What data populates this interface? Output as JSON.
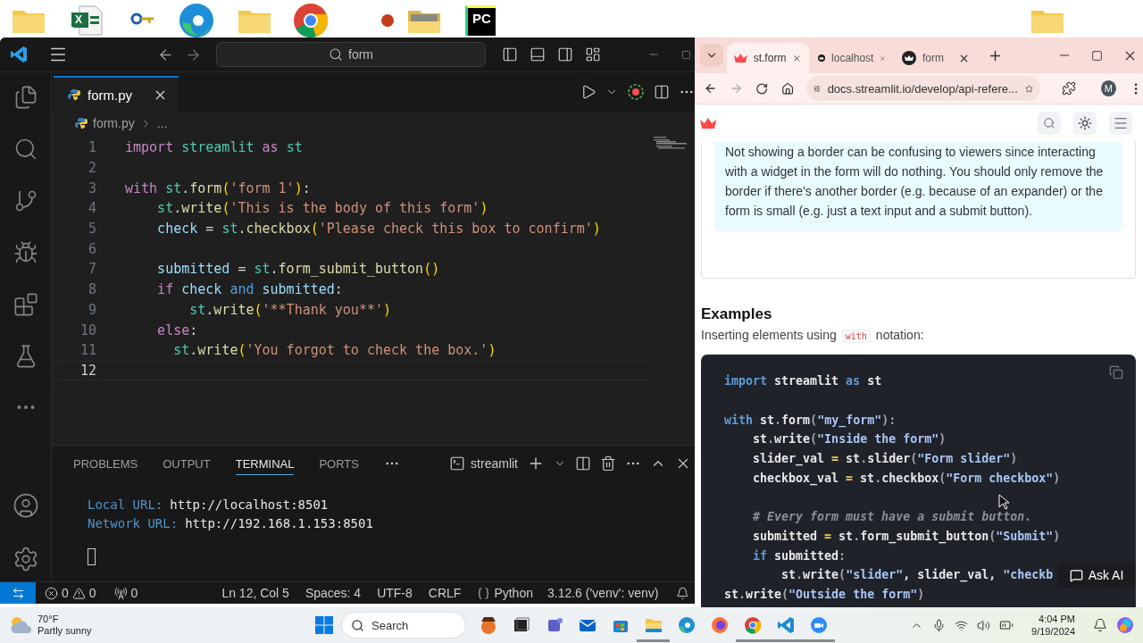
{
  "desktop_icons": [
    {
      "kind": "folder"
    },
    {
      "kind": "excel",
      "label": "X"
    },
    {
      "kind": "key"
    },
    {
      "kind": "edge"
    },
    {
      "kind": "folder"
    },
    {
      "kind": "chrome"
    },
    {
      "kind": "slides"
    },
    {
      "kind": "photo-folder"
    },
    {
      "kind": "pycharm",
      "label": "PC"
    },
    {
      "kind": "folder"
    }
  ],
  "vscode": {
    "title_search": "form",
    "editor_tab": {
      "label": "form.py",
      "selected": true
    },
    "breadcrumb": [
      "form.py",
      "..."
    ],
    "code_lines": [
      {
        "number": "1",
        "current": false,
        "tokens": [
          {
            "text": "import ",
            "kind": "kw"
          },
          {
            "text": "streamlit ",
            "kind": "mod"
          },
          {
            "text": "as ",
            "kind": "kw"
          },
          {
            "text": "st",
            "kind": "mod"
          }
        ]
      },
      {
        "number": "2",
        "current": false
      },
      {
        "number": "3",
        "current": false,
        "tokens": [
          {
            "text": "with ",
            "kind": "kw"
          },
          {
            "text": "st",
            "kind": "mod"
          },
          {
            "text": ".",
            "kind": "p"
          },
          {
            "text": "form",
            "kind": "fn"
          },
          {
            "text": "(",
            "kind": "br"
          },
          {
            "text": "'form 1'",
            "kind": "str"
          },
          {
            "text": ")",
            "kind": "br"
          },
          {
            "text": ":",
            "kind": "p"
          }
        ]
      },
      {
        "number": "4",
        "current": false,
        "tokens": [
          {
            "text": "    st",
            "kind": "mod"
          },
          {
            "text": ".",
            "kind": "p"
          },
          {
            "text": "write",
            "kind": "fn"
          },
          {
            "text": "(",
            "kind": "br"
          },
          {
            "text": "'This is the body of this form'",
            "kind": "str"
          },
          {
            "text": ")",
            "kind": "br"
          }
        ]
      },
      {
        "number": "5",
        "current": false,
        "tokens": [
          {
            "text": "    check",
            "kind": "var"
          },
          {
            "text": " = ",
            "kind": "p"
          },
          {
            "text": "st",
            "kind": "mod"
          },
          {
            "text": ".",
            "kind": "p"
          },
          {
            "text": "checkbox",
            "kind": "fn"
          },
          {
            "text": "(",
            "kind": "br"
          },
          {
            "text": "'Please check this box to confirm'",
            "kind": "str"
          },
          {
            "text": ")",
            "kind": "br"
          }
        ]
      },
      {
        "number": "6",
        "current": false
      },
      {
        "number": "7",
        "current": false,
        "tokens": [
          {
            "text": "    submitted",
            "kind": "var"
          },
          {
            "text": " = ",
            "kind": "p"
          },
          {
            "text": "st",
            "kind": "mod"
          },
          {
            "text": ".",
            "kind": "p"
          },
          {
            "text": "form_submit_button",
            "kind": "fn"
          },
          {
            "text": "()",
            "kind": "br"
          }
        ]
      },
      {
        "number": "8",
        "current": false,
        "tokens": [
          {
            "text": "    if ",
            "kind": "kw"
          },
          {
            "text": "check ",
            "kind": "var"
          },
          {
            "text": "and ",
            "kind": "op"
          },
          {
            "text": "submitted",
            "kind": "var"
          },
          {
            "text": ":",
            "kind": "p"
          }
        ]
      },
      {
        "number": "9",
        "current": false,
        "tokens": [
          {
            "text": "        st",
            "kind": "mod"
          },
          {
            "text": ".",
            "kind": "p"
          },
          {
            "text": "write",
            "kind": "fn"
          },
          {
            "text": "(",
            "kind": "br"
          },
          {
            "text": "'**Thank you**'",
            "kind": "str"
          },
          {
            "text": ")",
            "kind": "br"
          }
        ]
      },
      {
        "number": "10",
        "current": false,
        "tokens": [
          {
            "text": "    else",
            "kind": "kw"
          },
          {
            "text": ":",
            "kind": "p"
          }
        ]
      },
      {
        "number": "11",
        "current": false,
        "tokens": [
          {
            "text": "      st",
            "kind": "mod"
          },
          {
            "text": ".",
            "kind": "p"
          },
          {
            "text": "write",
            "kind": "fn"
          },
          {
            "text": "(",
            "kind": "br"
          },
          {
            "text": "'You forgot to check the box.'",
            "kind": "str"
          },
          {
            "text": ")",
            "kind": "br"
          }
        ]
      },
      {
        "number": "12",
        "current": true
      }
    ],
    "panel_tabs": [
      {
        "label": "PROBLEMS",
        "selected": false
      },
      {
        "label": "OUTPUT",
        "selected": false
      },
      {
        "label": "TERMINAL",
        "selected": true
      },
      {
        "label": "PORTS",
        "selected": false
      }
    ],
    "terminal_name": "streamlit",
    "terminal_lines": [
      {
        "label": "Local URL:",
        "value": "http://localhost:8501"
      },
      {
        "label": "Network URL:",
        "value": "http://192.168.1.153:8501"
      }
    ],
    "status": {
      "errors": "0",
      "warnings": "0",
      "ports": "0",
      "items": [
        "Ln 12, Col 5",
        "Spaces: 4",
        "UTF-8",
        "CRLF"
      ],
      "language": "Python",
      "interpreter": "3.12.6 ('venv': venv)"
    }
  },
  "browser": {
    "tabs": [
      {
        "label": "st.form",
        "kind": "docs",
        "selected": true
      },
      {
        "label": "localhost",
        "kind": "app",
        "selected": false
      },
      {
        "label": "form",
        "kind": "app",
        "selected": false
      }
    ],
    "address": "docs.streamlit.io/develop/api-refere...",
    "profile": "M",
    "callout": "Not showing a border can be confusing to viewers since interacting with a widget in the form will do nothing. You should only remove the border if there's another border (e.g. because of an expander) or the form is small (e.g. just a text input and a submit button).",
    "heading": "Examples",
    "intro": {
      "before": "Inserting elements using",
      "code": "with",
      "after": "notation:"
    },
    "code_lines": [
      {
        "kind": "code",
        "tokens": [
          {
            "text": "import",
            "kind": "kw"
          },
          {
            "text": " streamlit ",
            "kind": "p"
          },
          {
            "text": "as",
            "kind": "kw"
          },
          {
            "text": " st",
            "kind": "p"
          }
        ]
      },
      {
        "kind": "blank"
      },
      {
        "kind": "code",
        "tokens": [
          {
            "text": "with",
            "kind": "kw"
          },
          {
            "text": " st",
            "kind": "p"
          },
          {
            "text": ".",
            "kind": "d"
          },
          {
            "text": "form",
            "kind": "p"
          },
          {
            "text": "(",
            "kind": "d"
          },
          {
            "text": "\"my_form\"",
            "kind": "str"
          },
          {
            "text": ")",
            "kind": "d"
          },
          {
            "text": ":",
            "kind": "d"
          }
        ]
      },
      {
        "kind": "code",
        "tokens": [
          {
            "text": "    st",
            "kind": "p"
          },
          {
            "text": ".",
            "kind": "d"
          },
          {
            "text": "write",
            "kind": "p"
          },
          {
            "text": "(",
            "kind": "d"
          },
          {
            "text": "\"Inside the form\"",
            "kind": "str"
          },
          {
            "text": ")",
            "kind": "d"
          }
        ]
      },
      {
        "kind": "code",
        "tokens": [
          {
            "text": "    slider_val ",
            "kind": "p"
          },
          {
            "text": "=",
            "kind": "op"
          },
          {
            "text": " st",
            "kind": "p"
          },
          {
            "text": ".",
            "kind": "d"
          },
          {
            "text": "slider",
            "kind": "p"
          },
          {
            "text": "(",
            "kind": "d"
          },
          {
            "text": "\"Form slider\"",
            "kind": "str"
          },
          {
            "text": ")",
            "kind": "d"
          }
        ]
      },
      {
        "kind": "code",
        "tokens": [
          {
            "text": "    checkbox_val ",
            "kind": "p"
          },
          {
            "text": "=",
            "kind": "op"
          },
          {
            "text": " st",
            "kind": "p"
          },
          {
            "text": ".",
            "kind": "d"
          },
          {
            "text": "checkbox",
            "kind": "p"
          },
          {
            "text": "(",
            "kind": "d"
          },
          {
            "text": "\"Form checkbox\"",
            "kind": "str"
          },
          {
            "text": ")",
            "kind": "d"
          }
        ]
      },
      {
        "kind": "blank"
      },
      {
        "kind": "code",
        "tokens": [
          {
            "text": "    # Every form must have a submit button.",
            "kind": "cm"
          }
        ]
      },
      {
        "kind": "code",
        "tokens": [
          {
            "text": "    submitted ",
            "kind": "p"
          },
          {
            "text": "=",
            "kind": "op"
          },
          {
            "text": " st",
            "kind": "p"
          },
          {
            "text": ".",
            "kind": "d"
          },
          {
            "text": "form_submit_button",
            "kind": "p"
          },
          {
            "text": "(",
            "kind": "d"
          },
          {
            "text": "\"Submit\"",
            "kind": "str"
          },
          {
            "text": ")",
            "kind": "d"
          }
        ]
      },
      {
        "kind": "code",
        "tokens": [
          {
            "text": "    if",
            "kind": "kw"
          },
          {
            "text": " submitted",
            "kind": "p"
          },
          {
            "text": ":",
            "kind": "d"
          }
        ]
      },
      {
        "kind": "code",
        "tokens": [
          {
            "text": "        st",
            "kind": "p"
          },
          {
            "text": ".",
            "kind": "d"
          },
          {
            "text": "write",
            "kind": "p"
          },
          {
            "text": "(",
            "kind": "d"
          },
          {
            "text": "\"slider\"",
            "kind": "str"
          },
          {
            "text": ", slider_val, ",
            "kind": "p"
          },
          {
            "text": "\"checkb",
            "kind": "str"
          }
        ]
      },
      {
        "kind": "code",
        "tokens": [
          {
            "text": "st",
            "kind": "p"
          },
          {
            "text": ".",
            "kind": "d"
          },
          {
            "text": "write",
            "kind": "p"
          },
          {
            "text": "(",
            "kind": "d"
          },
          {
            "text": "\"Outside the form\"",
            "kind": "str"
          },
          {
            "text": ")",
            "kind": "d"
          }
        ]
      }
    ],
    "ask_ai": "Ask AI"
  },
  "taskbar": {
    "temperature": "70°F",
    "weather": "Partly sunny",
    "search": "Search",
    "time": "4:04 PM",
    "date": "9/19/2024",
    "apps": [
      {
        "kind": "pirate",
        "running": false
      },
      {
        "kind": "taskview",
        "running": false
      },
      {
        "kind": "teams",
        "running": false
      },
      {
        "kind": "mail",
        "running": false
      },
      {
        "kind": "store",
        "running": false
      },
      {
        "kind": "explorer",
        "running": true
      },
      {
        "kind": "edge",
        "running": false
      },
      {
        "kind": "firefox",
        "running": false
      },
      {
        "kind": "chrome",
        "running": true
      },
      {
        "kind": "vscode",
        "running": true
      },
      {
        "kind": "zoom",
        "running": true
      }
    ]
  }
}
